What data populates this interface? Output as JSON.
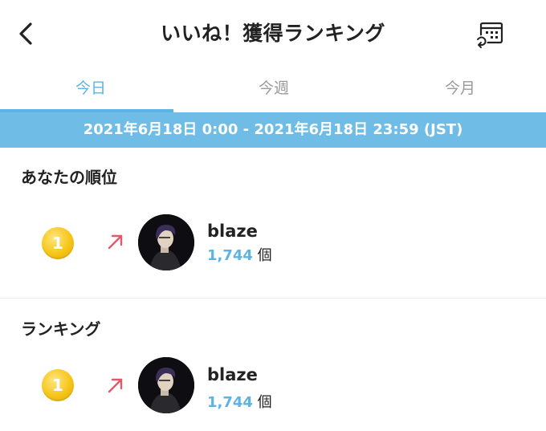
{
  "header": {
    "title": "いいね！獲得ランキング"
  },
  "tabs": [
    {
      "label": "今日",
      "active": true
    },
    {
      "label": "今週",
      "active": false
    },
    {
      "label": "今月",
      "active": false
    }
  ],
  "date_range": "2021年6月18日 0:00 - 2021年6月18日 23:59 (JST)",
  "my_rank": {
    "title": "あなたの順位",
    "entry": {
      "rank": "1",
      "trend": "up",
      "name": "blaze",
      "count": "1,744",
      "unit": "個"
    }
  },
  "ranking": {
    "title": "ランキング",
    "entries": [
      {
        "rank": "1",
        "trend": "up",
        "name": "blaze",
        "count": "1,744",
        "unit": "個"
      }
    ]
  },
  "colors": {
    "accent": "#5db3e4",
    "date_bar": "#6fbde6",
    "trend_up": "#e05a6a",
    "medal": "#f5c518"
  }
}
